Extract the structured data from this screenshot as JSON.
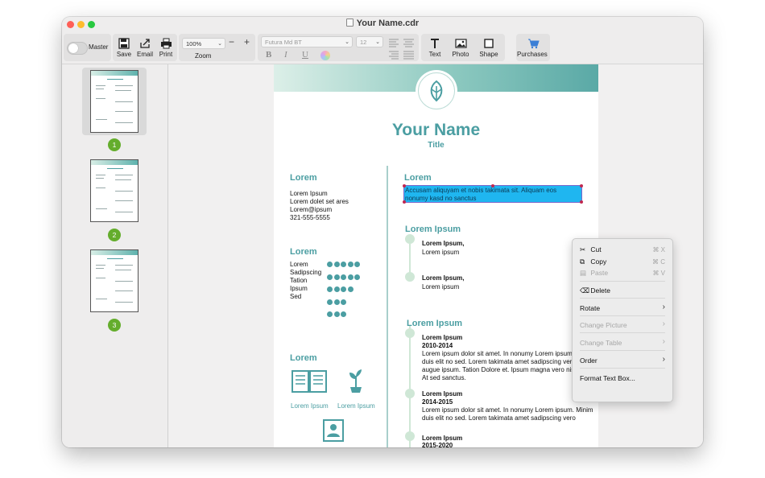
{
  "window": {
    "title": "Your Name.cdr"
  },
  "toolbar": {
    "master_label": "Master",
    "save_label": "Save",
    "email_label": "Email",
    "print_label": "Print",
    "zoom_value": "100%",
    "zoom_label": "Zoom",
    "zoom_minus": "−",
    "zoom_plus": "+",
    "font_value": "Futura Md BT",
    "size_value": "12",
    "bold": "B",
    "italic": "I",
    "underline": "U",
    "text_label": "Text",
    "photo_label": "Photo",
    "shape_label": "Shape",
    "purchases_label": "Purchases"
  },
  "sidebar": {
    "pages": [
      {
        "number": "1"
      },
      {
        "number": "2"
      },
      {
        "number": "3"
      }
    ]
  },
  "document": {
    "name": "Your Name",
    "subtitle": "Title",
    "left": {
      "contact_heading": "Lorem",
      "contact_lines": [
        "Lorem Ipsum",
        "Lorem dolet set ares",
        "Lorem@ipsum",
        "321-555-5555"
      ],
      "skills_heading": "Lorem",
      "skills": [
        {
          "name": "Lorem",
          "level": 5
        },
        {
          "name": "Sadipscing",
          "level": 5
        },
        {
          "name": "Tation",
          "level": 4
        },
        {
          "name": "Ipsum",
          "level": 3
        },
        {
          "name": "Sed",
          "level": 3
        }
      ],
      "interests_heading": "Lorem",
      "interest_1": "Lorem Ipsum",
      "interest_2": "Lorem Ipsum"
    },
    "right": {
      "profile_heading": "Lorem",
      "profile_line_1": "Accusam aliquyam et nobis takimata sit. Aliquam eos",
      "profile_line_2": "nonumy kasd no sanctus",
      "experience_heading": "Lorem Ipsum",
      "exp_1_title": "Lorem Ipsum,",
      "exp_1_text": "Lorem ipsum",
      "exp_2_title": "Lorem Ipsum,",
      "exp_2_text": "Lorem ipsum",
      "education_heading": "Lorem Ipsum",
      "edu_1_title": "Lorem Ipsum",
      "edu_1_years": "2010-2014",
      "edu_1_lines": [
        "Lorem ipsum dolor sit amet. In nonumy Lorem ipsum. Minim",
        "duis elit no sed. Lorem takimata amet sadipscing vero",
        "augue ipsum. Tation Dolore et. Ipsum magna vero nisl diam.",
        "At sed sanctus."
      ],
      "edu_2_title": "Lorem Ipsum",
      "edu_2_years": "2014-2015",
      "edu_2_lines": [
        "Lorem ipsum dolor sit amet. In nonumy Lorem ipsum. Minim",
        "duis elit no sed. Lorem takimata amet sadipscing vero"
      ],
      "edu_3_title": "Lorem Ipsum",
      "edu_3_years": "2015-2020"
    }
  },
  "context_menu": {
    "cut": "Cut",
    "cut_sc": "⌘ X",
    "copy": "Copy",
    "copy_sc": "⌘ C",
    "paste": "Paste",
    "paste_sc": "⌘ V",
    "delete": "Delete",
    "rotate": "Rotate",
    "change_picture": "Change Picture",
    "change_table": "Change Table",
    "order": "Order",
    "format_text_box": "Format Text Box..."
  },
  "colors": {
    "accent": "#4b9ea2",
    "selection": "#1fb6f0",
    "badge": "#64ad2c",
    "purchases": "#3b7fd6"
  }
}
